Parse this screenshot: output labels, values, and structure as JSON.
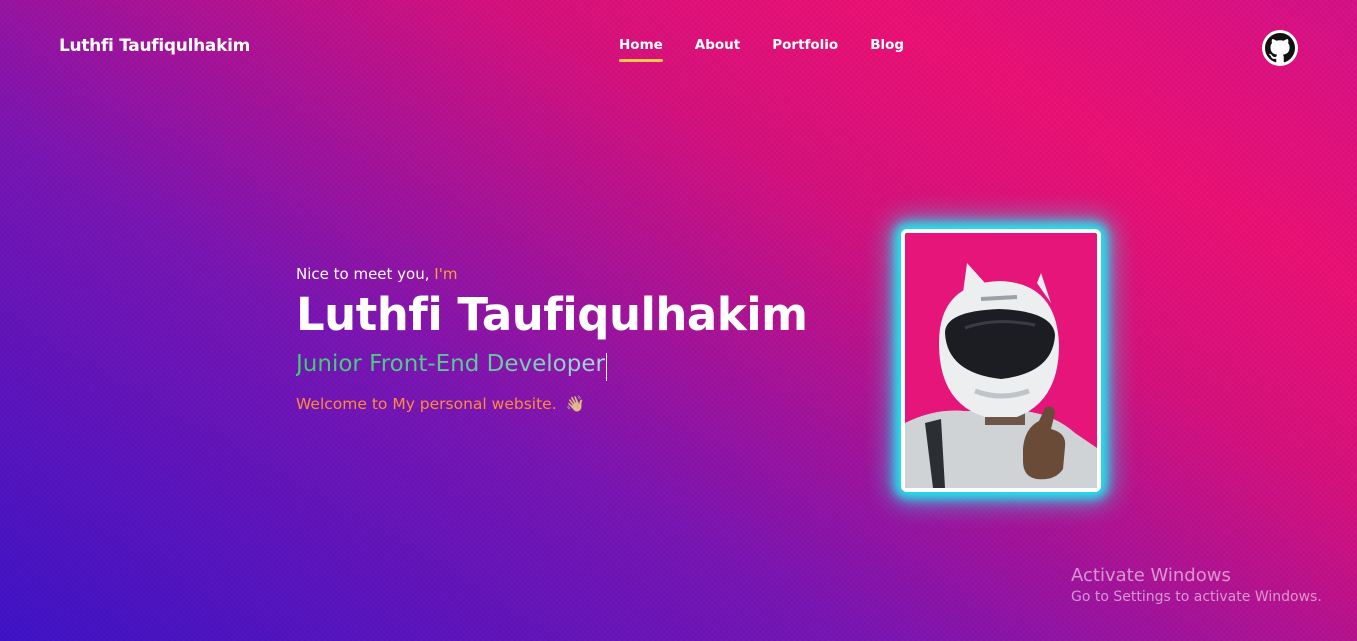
{
  "header": {
    "brand": "Luthfi Taufiqulhakim",
    "nav": [
      {
        "label": "Home",
        "active": true
      },
      {
        "label": "About",
        "active": false
      },
      {
        "label": "Portfolio",
        "active": false
      },
      {
        "label": "Blog",
        "active": false
      }
    ],
    "github_icon": "github-icon"
  },
  "hero": {
    "greeting": "Nice to meet you, ",
    "greeting_accent": "I'm",
    "name": "Luthfi Taufiqulhakim",
    "role": "Junior Front-End Developer",
    "welcome": "Welcome to My personal website.",
    "welcome_emoji": "👋🏼"
  },
  "photo": {
    "alt_icon": "profile-photo"
  },
  "watermark": {
    "title": "Activate Windows",
    "subtitle": "Go to Settings to activate Windows."
  },
  "colors": {
    "accent_underline": "#f7c948",
    "glow": "#23e4ee",
    "greeting_accent": "#f5a23b",
    "welcome": "#ff8a3d",
    "role_start": "#3ccf6e"
  }
}
